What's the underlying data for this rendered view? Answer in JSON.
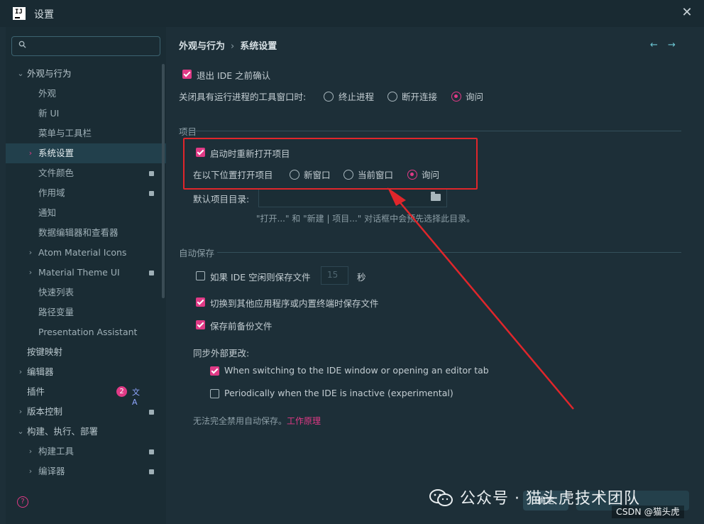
{
  "window": {
    "title": "设置",
    "logo_text": "IJ"
  },
  "sidebar": {
    "search_placeholder": "",
    "items": [
      {
        "label": "外观与行为",
        "chevron": "⌄",
        "bold": true
      },
      {
        "label": "外观"
      },
      {
        "label": "新 UI"
      },
      {
        "label": "菜单与工具栏"
      },
      {
        "label": "系统设置",
        "chevron": "›"
      },
      {
        "label": "文件颜色"
      },
      {
        "label": "作用域"
      },
      {
        "label": "通知"
      },
      {
        "label": "数据编辑器和查看器"
      },
      {
        "label": "Atom Material Icons",
        "chevron": "›"
      },
      {
        "label": "Material Theme UI",
        "chevron": "›"
      },
      {
        "label": "快速列表"
      },
      {
        "label": "路径变量"
      },
      {
        "label": "Presentation Assistant"
      },
      {
        "label": "按键映射",
        "bold": true
      },
      {
        "label": "编辑器",
        "chevron": "›",
        "bold": true
      },
      {
        "label": "插件",
        "bold": true
      },
      {
        "label": "版本控制",
        "chevron": "›",
        "bold": true
      },
      {
        "label": "构建、执行、部署",
        "chevron": "⌄",
        "bold": true
      },
      {
        "label": "构建工具",
        "chevron": "›"
      },
      {
        "label": "编译器",
        "chevron": "›"
      }
    ],
    "plugin_badge": "2",
    "help_label": "?"
  },
  "breadcrumb": {
    "parent": "外观与行为",
    "sep": "›",
    "current": "系统设置"
  },
  "nav": {
    "back": "←",
    "forward": "→"
  },
  "general": {
    "confirm_exit": "退出 IDE 之前确认",
    "close_tool_label": "关闭具有运行进程的工具窗口时:",
    "opt_terminate": "终止进程",
    "opt_disconnect": "断开连接",
    "opt_ask": "询问"
  },
  "project": {
    "section": "项目",
    "reopen": "启动时重新打开项目",
    "open_in_label": "在以下位置打开项目",
    "opt_new": "新窗口",
    "opt_current": "当前窗口",
    "opt_ask": "询问",
    "default_dir_label": "默认项目目录:",
    "default_dir_value": "",
    "hint": "\"打开...\" 和 \"新建 | 项目...\" 对话框中会预先选择此目录。"
  },
  "autosave": {
    "section": "自动保存",
    "idle": "如果 IDE 空闲则保存文件",
    "idle_seconds": "15",
    "seconds_unit": "秒",
    "switch": "切换到其他应用程序或内置终端时保存文件",
    "backup": "保存前备份文件",
    "sync_label": "同步外部更改:",
    "sync_switch": "When switching to the IDE window or opening an editor tab",
    "sync_periodic": "Periodically when the IDE is inactive (experimental)",
    "note": "无法完全禁用自动保存。",
    "note_link": "工作原理"
  },
  "buttons": {
    "ok": "确定",
    "cancel": "",
    "apply": ""
  },
  "watermark": {
    "text": "公众号 · 猫头虎技术团队",
    "csdn": "CSDN @猫头虎"
  },
  "colors": {
    "accent": "#e03a86",
    "annotation": "#e0262b",
    "bg": "#1d2f38"
  }
}
